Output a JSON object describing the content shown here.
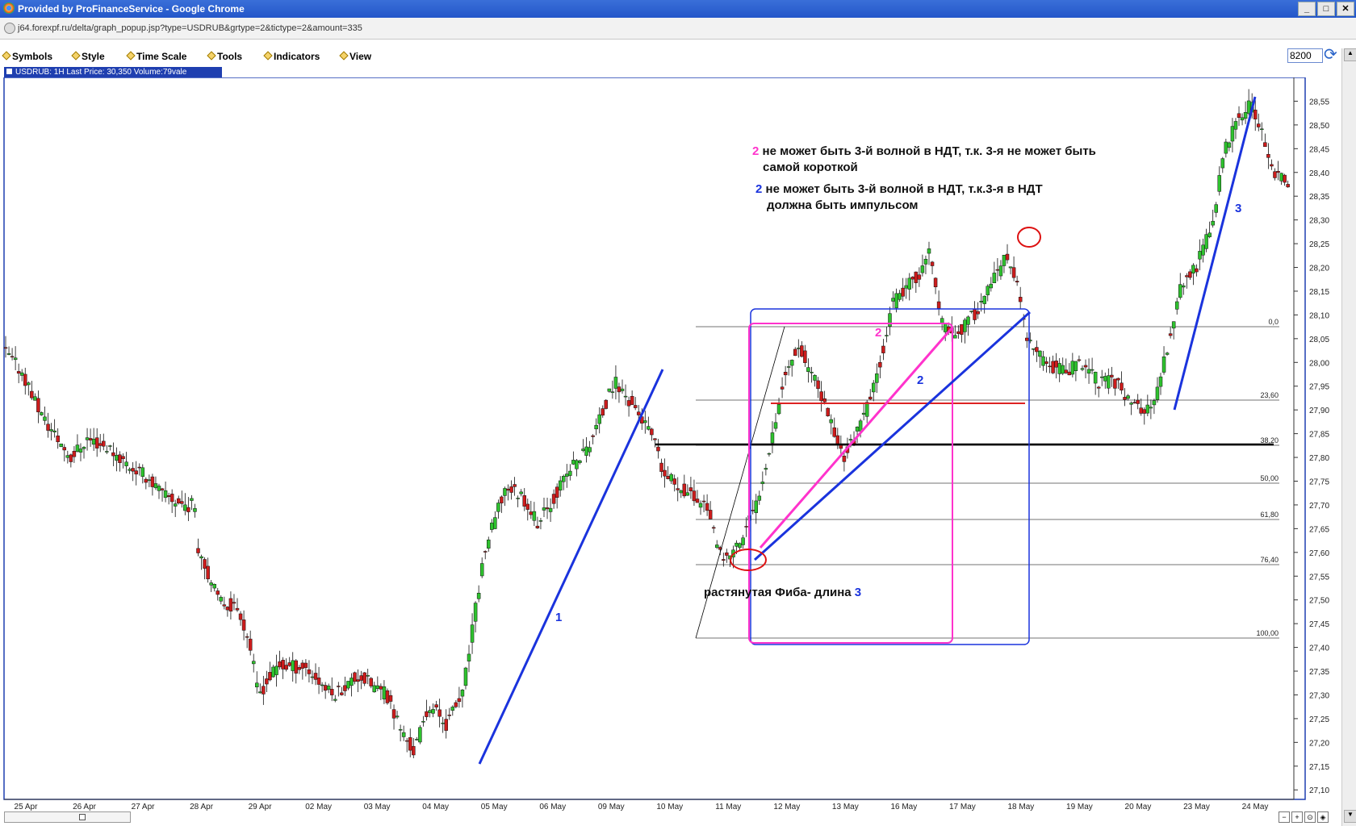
{
  "window": {
    "title": "Provided by ProFinanceService - Google Chrome",
    "url": "j64.forexpf.ru/delta/graph_popup.jsp?type=USDRUB&grtype=2&tictype=2&amount=335"
  },
  "menu": [
    "Symbols",
    "Style",
    "Time Scale",
    "Tools",
    "Indicators",
    "View"
  ],
  "amount_value": "8200",
  "tab_label": "USDRUB: 1H Last Price: 30,350 Volume:79vale",
  "chart_data": {
    "type": "candlestick",
    "symbol": "USDRUB",
    "ylim": [
      27.08,
      28.6
    ],
    "price_ticks": [
      28.55,
      28.5,
      28.45,
      28.4,
      28.35,
      28.3,
      28.25,
      28.2,
      28.15,
      28.1,
      28.05,
      28.0,
      27.95,
      27.9,
      27.85,
      27.8,
      27.75,
      27.7,
      27.65,
      27.6,
      27.55,
      27.5,
      27.45,
      27.4,
      27.35,
      27.3,
      27.25,
      27.2,
      27.15,
      27.1
    ],
    "date_labels": [
      "25 Apr",
      "26 Apr",
      "27 Apr",
      "28 Apr",
      "29 Apr",
      "02 May",
      "03 May",
      "04 May",
      "05 May",
      "06 May",
      "09 May",
      "10 May",
      "11 May",
      "12 May",
      "13 May",
      "16 May",
      "17 May",
      "18 May",
      "19 May",
      "20 May",
      "23 May",
      "24 May"
    ],
    "anchors": [
      [
        0,
        28.02
      ],
      [
        15,
        27.98
      ],
      [
        35,
        27.88
      ],
      [
        60,
        27.8
      ],
      [
        75,
        27.84
      ],
      [
        95,
        27.82
      ],
      [
        115,
        27.78
      ],
      [
        130,
        27.76
      ],
      [
        145,
        27.72
      ],
      [
        165,
        27.7
      ],
      [
        175,
        27.7
      ],
      [
        176,
        27.62
      ],
      [
        195,
        27.5
      ],
      [
        215,
        27.48
      ],
      [
        225,
        27.4
      ],
      [
        232,
        27.3
      ],
      [
        250,
        27.36
      ],
      [
        275,
        27.36
      ],
      [
        300,
        27.3
      ],
      [
        325,
        27.34
      ],
      [
        350,
        27.3
      ],
      [
        365,
        27.22
      ],
      [
        375,
        27.18
      ],
      [
        390,
        27.28
      ],
      [
        405,
        27.24
      ],
      [
        420,
        27.3
      ],
      [
        440,
        27.6
      ],
      [
        460,
        27.74
      ],
      [
        475,
        27.72
      ],
      [
        490,
        27.66
      ],
      [
        505,
        27.72
      ],
      [
        520,
        27.78
      ],
      [
        535,
        27.82
      ],
      [
        550,
        27.9
      ],
      [
        560,
        27.96
      ],
      [
        580,
        27.9
      ],
      [
        595,
        27.84
      ],
      [
        605,
        27.76
      ],
      [
        620,
        27.74
      ],
      [
        630,
        27.72
      ],
      [
        645,
        27.7
      ],
      [
        655,
        27.6
      ],
      [
        660,
        27.58
      ],
      [
        675,
        27.62
      ],
      [
        690,
        27.7
      ],
      [
        700,
        27.8
      ],
      [
        715,
        27.96
      ],
      [
        728,
        28.04
      ],
      [
        740,
        27.98
      ],
      [
        755,
        27.9
      ],
      [
        770,
        27.8
      ],
      [
        785,
        27.86
      ],
      [
        800,
        27.96
      ],
      [
        815,
        28.12
      ],
      [
        830,
        28.16
      ],
      [
        845,
        28.2
      ],
      [
        850,
        28.24
      ],
      [
        860,
        28.08
      ],
      [
        875,
        28.06
      ],
      [
        890,
        28.1
      ],
      [
        905,
        28.16
      ],
      [
        920,
        28.22
      ],
      [
        925,
        28.2
      ],
      [
        930,
        28.16
      ],
      [
        940,
        28.04
      ],
      [
        955,
        28.0
      ],
      [
        975,
        27.98
      ],
      [
        990,
        28.0
      ],
      [
        1005,
        27.96
      ],
      [
        1020,
        27.96
      ],
      [
        1035,
        27.92
      ],
      [
        1045,
        27.9
      ],
      [
        1055,
        27.9
      ],
      [
        1065,
        28.0
      ],
      [
        1080,
        28.16
      ],
      [
        1095,
        28.2
      ],
      [
        1110,
        28.3
      ],
      [
        1120,
        28.44
      ],
      [
        1135,
        28.52
      ],
      [
        1145,
        28.54
      ],
      [
        1155,
        28.48
      ],
      [
        1165,
        28.4
      ],
      [
        1175,
        28.38
      ]
    ]
  },
  "fib_levels": [
    "0,0",
    "23,60",
    "38,20",
    "50,00",
    "61,80",
    "76,40",
    "100,00"
  ],
  "annotations": {
    "note1_num": "2",
    "note1_text_a": "не может быть 3-й волной в НДТ, т.к. 3-я не может быть",
    "note1_text_b": "самой короткой",
    "note2_num": "2",
    "note2_text_a": "не может быть 3-й волной в НДТ, т.к.3-я в НДТ",
    "note2_text_b": "должна быть импульсом",
    "fib_caption": "растянутая Фиба- длина",
    "fib_caption_num": "3",
    "wave1": "1",
    "wave2_blue": "2",
    "wave2_pink": "2",
    "wave3": "3"
  },
  "colors": {
    "up": "#2ec22e",
    "down": "#cc1c1c",
    "trend_blue": "#1a33dd",
    "trend_pink": "#ff33cc",
    "red_circle": "#dd1111"
  }
}
